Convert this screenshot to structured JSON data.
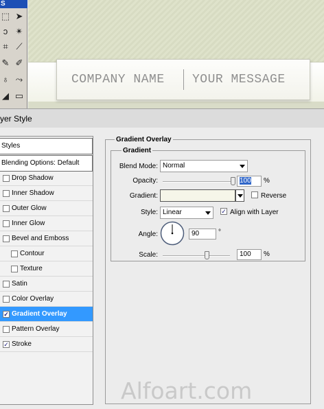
{
  "toolbar": {
    "title": "S",
    "tools": [
      "marquee-icon",
      "move-icon",
      "lasso-icon",
      "magic-wand-icon",
      "crop-icon",
      "slice-icon",
      "healing-brush-icon",
      "brush-icon",
      "stamp-icon",
      "history-brush-icon",
      "eraser-icon",
      "gradient-icon"
    ]
  },
  "banner": {
    "company": "COMPANY NAME",
    "message": "YOUR MESSAGE"
  },
  "dialog": {
    "title": "yer Style"
  },
  "styles_panel": {
    "header": "Styles",
    "blending": "Blending Options: Default",
    "items": [
      {
        "label": "Drop Shadow",
        "checked": false
      },
      {
        "label": "Inner Shadow",
        "checked": false
      },
      {
        "label": "Outer Glow",
        "checked": false
      },
      {
        "label": "Inner Glow",
        "checked": false
      },
      {
        "label": "Bevel and Emboss",
        "checked": false
      },
      {
        "label": "Contour",
        "checked": false
      },
      {
        "label": "Texture",
        "checked": false
      },
      {
        "label": "Satin",
        "checked": false
      },
      {
        "label": "Color Overlay",
        "checked": false
      },
      {
        "label": "Gradient Overlay",
        "checked": true
      },
      {
        "label": "Pattern Overlay",
        "checked": false
      },
      {
        "label": "Stroke",
        "checked": true
      }
    ],
    "check_mark": "✓"
  },
  "gradient_overlay": {
    "title": "Gradient Overlay",
    "section": "Gradient",
    "blend_mode_label": "Blend Mode:",
    "blend_mode_value": "Normal",
    "opacity_label": "Opacity:",
    "opacity_value": "100",
    "opacity_fraction": 1.0,
    "percent": "%",
    "gradient_label": "Gradient:",
    "gradient_color": "#f6f6e9",
    "reverse_label": "Reverse",
    "reverse_checked": false,
    "style_label": "Style:",
    "style_value": "Linear",
    "align_label": "Align with Layer",
    "align_checked": true,
    "angle_label": "Angle:",
    "angle_value": "90",
    "degree": "°",
    "scale_label": "Scale:",
    "scale_value": "100",
    "scale_fraction": 0.66
  },
  "watermark": "Alfoart.com",
  "colors": {
    "selected": "#3399ff",
    "title_bar": "#1c4fb5"
  }
}
